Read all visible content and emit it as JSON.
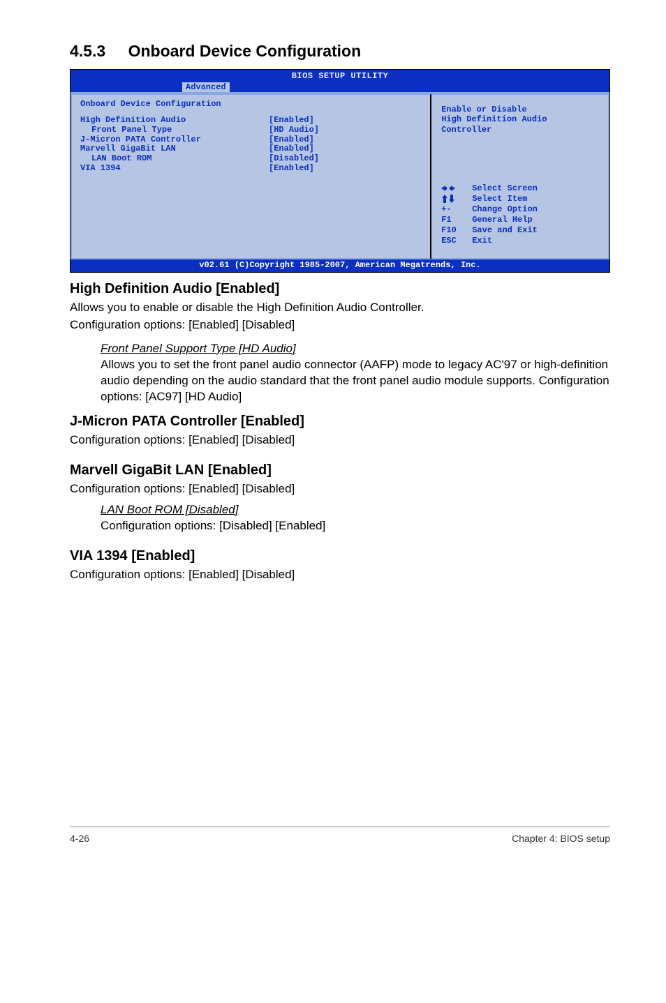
{
  "section": {
    "number": "4.5.3",
    "title": "Onboard Device Configuration"
  },
  "bios": {
    "header": "BIOS SETUP UTILITY",
    "tab": "Advanced",
    "panel_heading": "Onboard Device Configuration",
    "rows": [
      {
        "label": "High Definition Audio",
        "value": "[Enabled]",
        "indent": false
      },
      {
        "label": "Front Panel Type",
        "value": "[HD Audio]",
        "indent": true
      },
      {
        "label": "J-Micron PATA Controller",
        "value": "[Enabled]",
        "indent": false
      },
      {
        "label": "Marvell GigaBit LAN",
        "value": "[Enabled]",
        "indent": false
      },
      {
        "label": "LAN Boot ROM",
        "value": "[Disabled]",
        "indent": true
      },
      {
        "label": "VIA 1394",
        "value": "[Enabled]",
        "indent": false
      }
    ],
    "right_help_line1": "Enable or Disable",
    "right_help_line2": "High Definition Audio",
    "right_help_line3": "Controller",
    "keys": {
      "select_screen": "Select Screen",
      "select_item": "Select Item",
      "change_option_key": "+-",
      "change_option": "Change Option",
      "general_help_key": "F1",
      "general_help": "General Help",
      "save_exit_key": "F10",
      "save_exit": "Save and Exit",
      "exit_key": "ESC",
      "exit": "Exit"
    },
    "footer": "v02.61 (C)Copyright 1985-2007, American Megatrends, Inc."
  },
  "doc": {
    "hdaudio": {
      "heading": "High Definition Audio [Enabled]",
      "p1": "Allows you to enable or disable the High Definition Audio Controller.",
      "p2": "Configuration options: [Enabled] [Disabled]",
      "sub_heading": "Front Panel Support Type [HD Audio]",
      "sub_p": "Allows you to set the front panel audio connector (AAFP) mode to legacy AC'97 or high-definition audio depending on the audio standard that the front panel audio module supports. Configuration options: [AC97] [HD Audio]"
    },
    "jmicron": {
      "heading": "J-Micron PATA Controller [Enabled]",
      "p": "Configuration options: [Enabled] [Disabled]"
    },
    "marvell": {
      "heading": "Marvell GigaBit LAN [Enabled]",
      "p": "Configuration options: [Enabled] [Disabled]",
      "sub_heading": "LAN Boot ROM [Disabled]",
      "sub_p": "Configuration options: [Disabled] [Enabled]"
    },
    "via": {
      "heading": "VIA 1394 [Enabled]",
      "p": "Configuration options: [Enabled] [Disabled]"
    }
  },
  "footer": {
    "left": "4-26",
    "right": "Chapter 4: BIOS setup"
  }
}
